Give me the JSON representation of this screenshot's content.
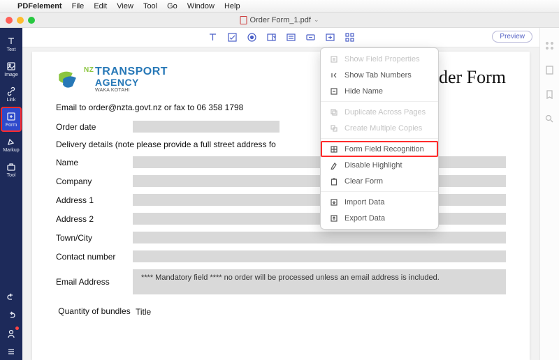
{
  "menubar": {
    "app_name": "PDFelement",
    "items": [
      "File",
      "Edit",
      "View",
      "Tool",
      "Go",
      "Window",
      "Help"
    ]
  },
  "document": {
    "title": "Order Form_1.pdf"
  },
  "sidebar": {
    "items": [
      {
        "id": "text",
        "label": "Text"
      },
      {
        "id": "image",
        "label": "Image"
      },
      {
        "id": "link",
        "label": "Link"
      },
      {
        "id": "form",
        "label": "Form"
      },
      {
        "id": "markup",
        "label": "Markup"
      },
      {
        "id": "tool",
        "label": "Tool"
      }
    ]
  },
  "toolbar": {
    "preview_label": "Preview"
  },
  "dropdown": {
    "items": [
      {
        "label": "Show Field Properties",
        "disabled": true
      },
      {
        "label": "Show Tab Numbers",
        "disabled": false
      },
      {
        "label": "Hide Name",
        "disabled": false
      },
      {
        "label": "Duplicate Across Pages",
        "disabled": true
      },
      {
        "label": "Create Multiple Copies",
        "disabled": true
      },
      {
        "label": "Form Field Recognition",
        "disabled": false,
        "highlight": true
      },
      {
        "label": "Disable Highlight",
        "disabled": false
      },
      {
        "label": "Clear Form",
        "disabled": false
      },
      {
        "label": "Import Data",
        "disabled": false
      },
      {
        "label": "Export Data",
        "disabled": false
      }
    ]
  },
  "pdf": {
    "logo": {
      "line1": "TRANSPORT",
      "line2": "AGENCY",
      "line3": "WAKA KOTAHI"
    },
    "title": "Order Form",
    "email_line": "Email to order@nzta.govt.nz or fax to 06 358 1798",
    "order_date_label": "Order date",
    "delivery_section": "Delivery details (note please provide a full street address fo",
    "fields": {
      "name": "Name",
      "company": "Company",
      "address1": "Address 1",
      "address2": "Address 2",
      "town": "Town/City",
      "contact": "Contact number",
      "email": "Email Address"
    },
    "mandatory_note": "**** Mandatory field **** no order will be processed unless an email address is included.",
    "table": {
      "qty_header": "Quantity of bundles",
      "title_header": "Title"
    }
  }
}
